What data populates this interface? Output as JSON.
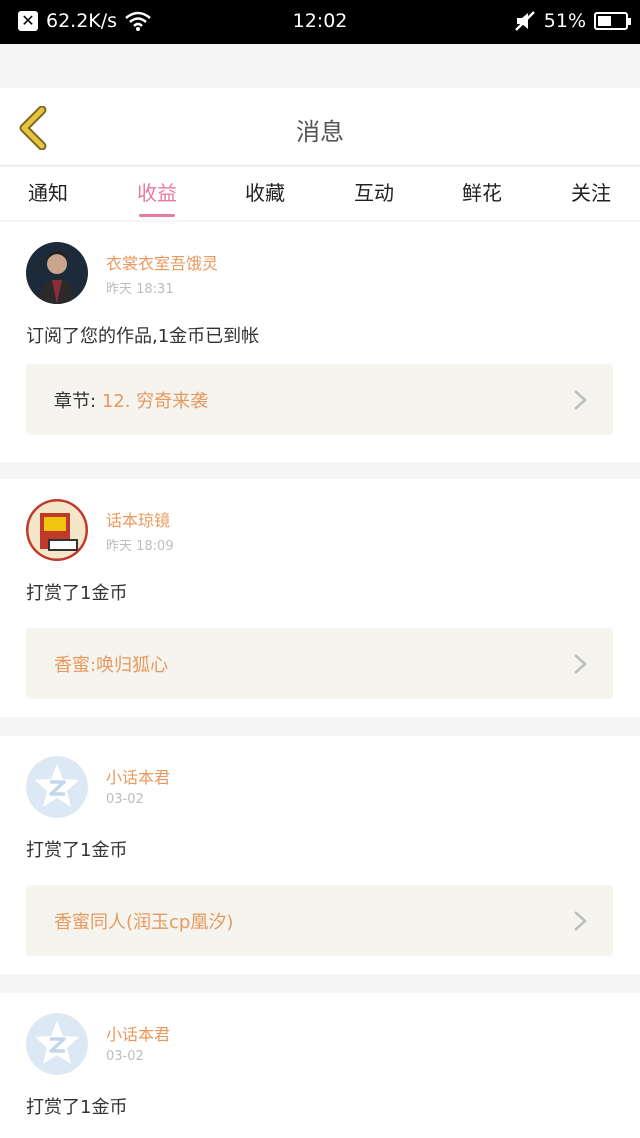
{
  "status_bar": {
    "network_speed": "62.2K/s",
    "time": "12:02",
    "battery": "51%",
    "battery_level": 0.51
  },
  "header": {
    "title": "消息"
  },
  "tabs": [
    {
      "label": "通知",
      "active": false
    },
    {
      "label": "收益",
      "active": true
    },
    {
      "label": "收藏",
      "active": false
    },
    {
      "label": "互动",
      "active": false
    },
    {
      "label": "鲜花",
      "active": false
    },
    {
      "label": "关注",
      "active": false
    }
  ],
  "messages": [
    {
      "user": "衣裳衣室吾饿灵",
      "time": "昨天 18:31",
      "text": "订阅了您的作品,1金币已到帐",
      "link_label": "章节:",
      "link_text": "12. 穷奇来袭",
      "avatar": "portrait-avatar"
    },
    {
      "user": "话本琼镜",
      "time": "昨天 18:09",
      "text": "打赏了1金币",
      "link_label": "",
      "link_text": "香蜜:唤归狐心",
      "avatar": "book-avatar"
    },
    {
      "user": "小话本君",
      "time": "03-02",
      "text": "打赏了1金币",
      "link_label": "",
      "link_text": "香蜜同人(润玉cp凰汐)",
      "avatar": "z-star-avatar"
    },
    {
      "user": "小话本君",
      "time": "03-02",
      "text": "打赏了1金币",
      "link_label": "",
      "link_text": "",
      "avatar": "z-star-avatar"
    }
  ],
  "colors": {
    "accent_pink": "#e87aa2",
    "name_orange": "#e8995f",
    "link_bg": "#f5f4ee",
    "back_yellow": "#e8c43a"
  }
}
